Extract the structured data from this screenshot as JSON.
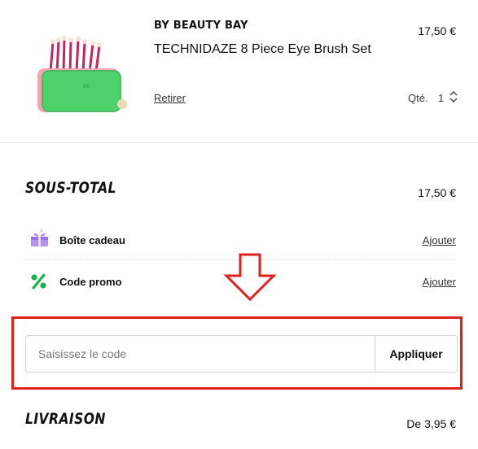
{
  "product": {
    "brand": "BY BEAUTY BAY",
    "name": "TECHNIDAZE 8 Piece Eye Brush Set",
    "price": "17,50 €",
    "remove_label": "Retirer",
    "qty_label": "Qté.",
    "qty_value": "1",
    "image_icon": "brush-set-image"
  },
  "summary": {
    "subtotal_title": "SOUS-TOTAL",
    "subtotal_value": "17,50 €",
    "gift": {
      "label": "Boîte cadeau",
      "link": "Ajouter",
      "icon": "gift-box-icon"
    },
    "promo": {
      "label": "Code promo",
      "link": "Ajouter",
      "icon": "percent-icon"
    }
  },
  "promo_form": {
    "placeholder": "Saisissez le code",
    "value": "",
    "apply_label": "Appliquer"
  },
  "shipping": {
    "title": "LIVRAISON",
    "value": "De 3,95 €"
  },
  "colors": {
    "highlight_border": "#e0201b",
    "gift_icon": "#a87ce6",
    "promo_icon": "#16b34a",
    "brush_case": "#4fd16b"
  }
}
